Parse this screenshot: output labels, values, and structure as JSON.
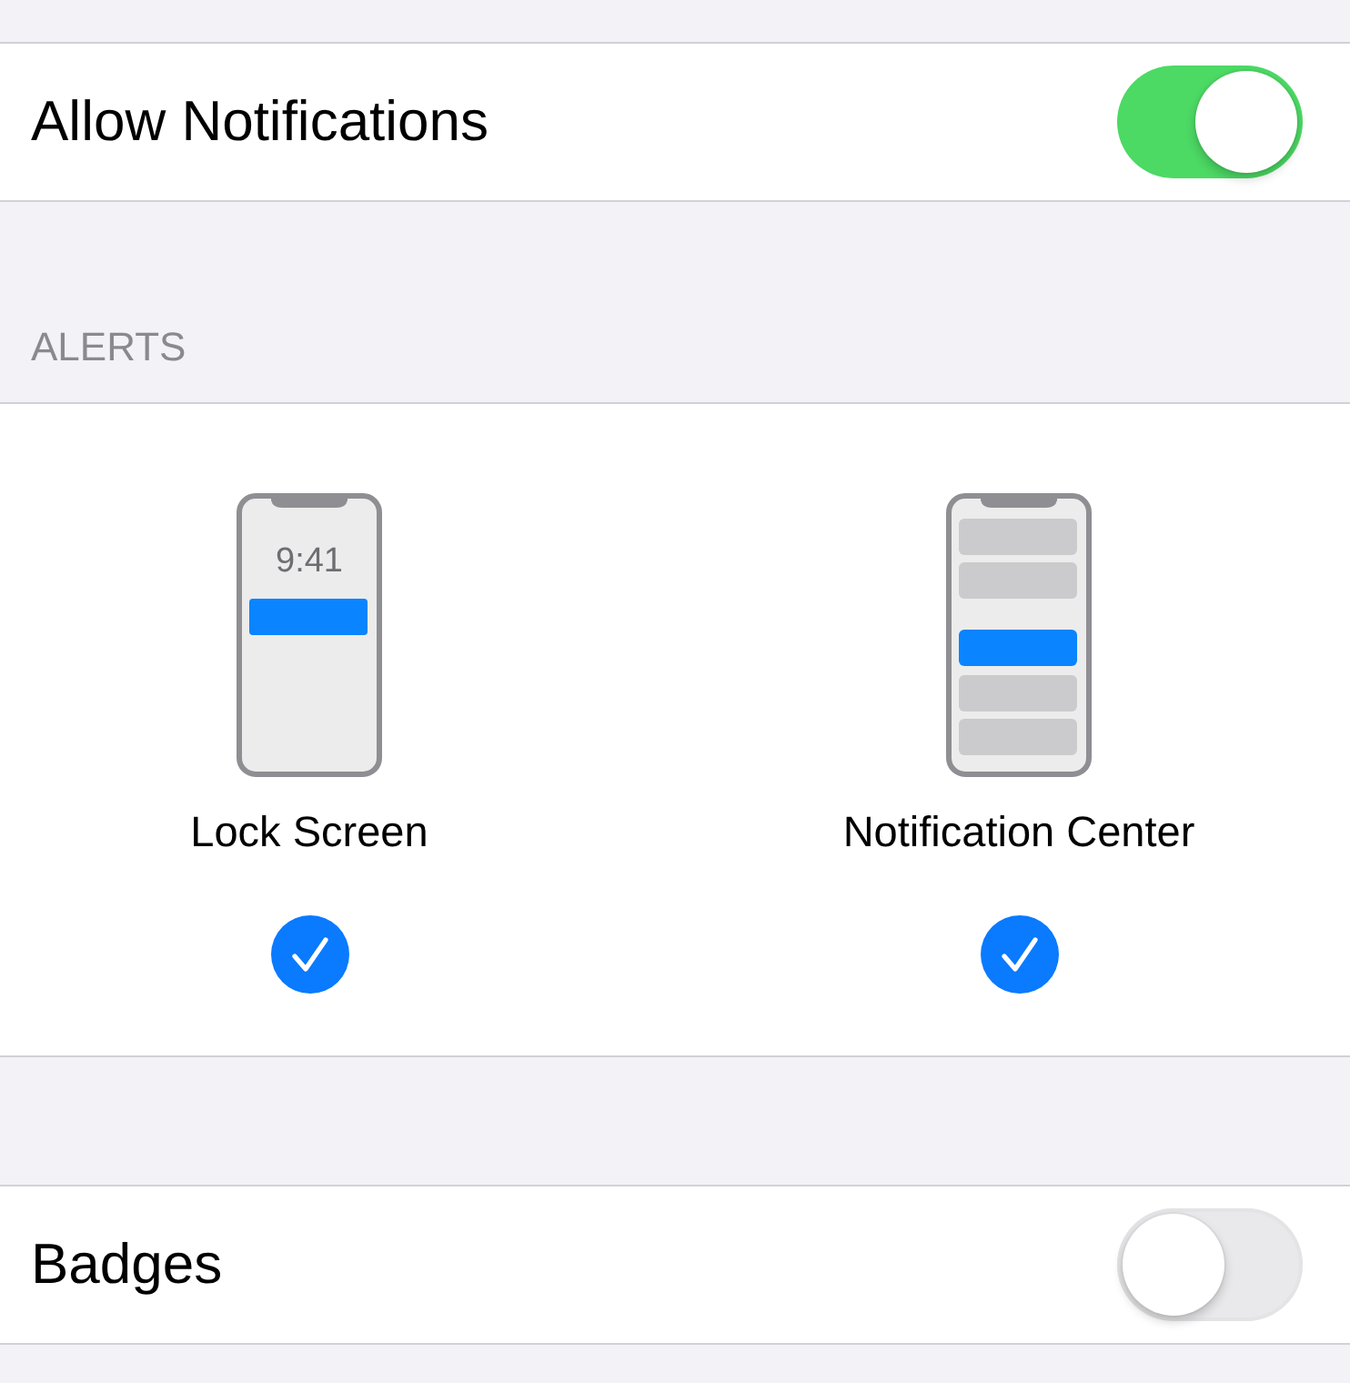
{
  "allow_notifications": {
    "label": "Allow Notifications",
    "on": true
  },
  "alerts": {
    "header": "ALERTS",
    "options": [
      {
        "kind": "lock_screen",
        "label": "Lock Screen",
        "time": "9:41",
        "checked": true
      },
      {
        "kind": "notification_center",
        "label": "Notification Center",
        "checked": true
      }
    ]
  },
  "badges": {
    "label": "Badges",
    "on": false
  }
}
